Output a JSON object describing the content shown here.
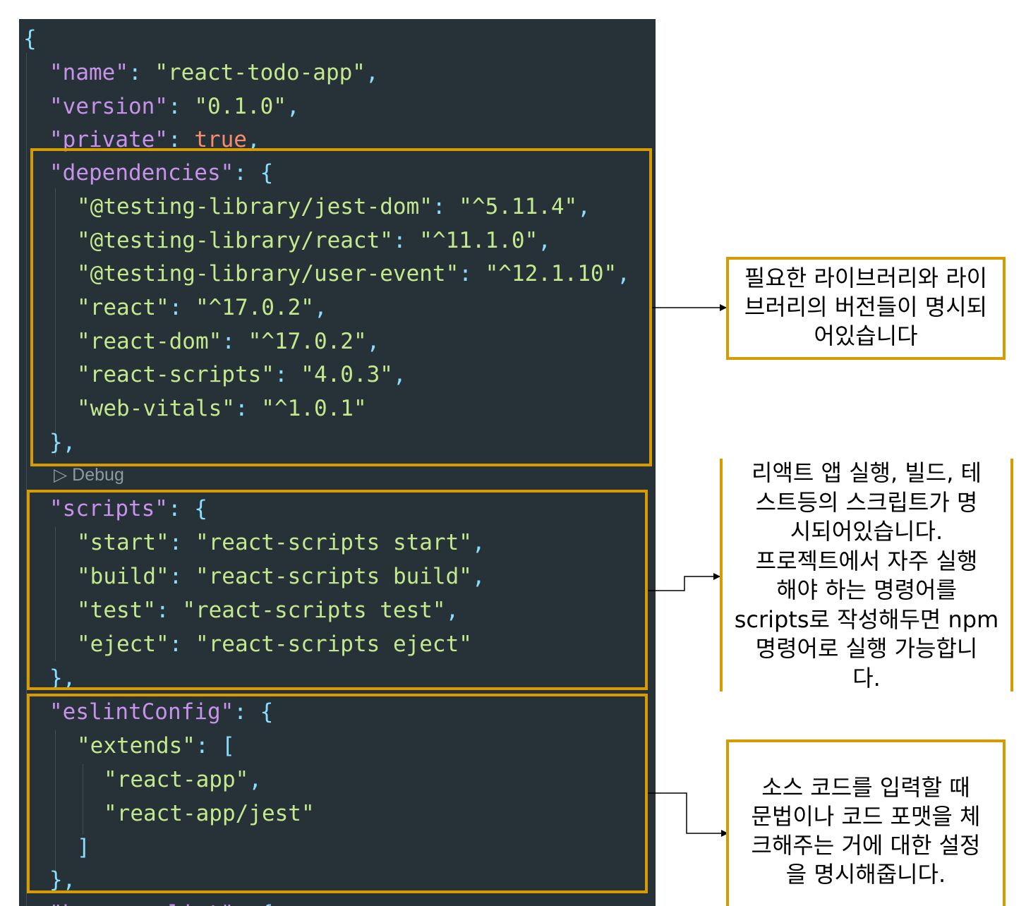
{
  "code_lines": [
    {
      "t": [
        {
          "c": "p",
          "v": "{"
        }
      ]
    },
    {
      "t": [
        {
          "c": "k",
          "v": "\"name\""
        },
        {
          "c": "p",
          "v": ": "
        },
        {
          "c": "s",
          "v": "\"react-todo-app\""
        },
        {
          "c": "p",
          "v": ","
        }
      ]
    },
    {
      "t": [
        {
          "c": "k",
          "v": "\"version\""
        },
        {
          "c": "p",
          "v": ": "
        },
        {
          "c": "s",
          "v": "\"0.1.0\""
        },
        {
          "c": "p",
          "v": ","
        }
      ]
    },
    {
      "t": [
        {
          "c": "k",
          "v": "\"private\""
        },
        {
          "c": "p",
          "v": ": "
        },
        {
          "c": "b",
          "v": "true"
        },
        {
          "c": "p",
          "v": ","
        }
      ]
    },
    {
      "t": [
        {
          "c": "k",
          "v": "\"dependencies\""
        },
        {
          "c": "p",
          "v": ": {"
        }
      ]
    },
    {
      "t": [
        {
          "c": "s",
          "v": "\"@testing-library/jest-dom\""
        },
        {
          "c": "p",
          "v": ": "
        },
        {
          "c": "s",
          "v": "\"^5.11.4\""
        },
        {
          "c": "p",
          "v": ","
        }
      ]
    },
    {
      "t": [
        {
          "c": "s",
          "v": "\"@testing-library/react\""
        },
        {
          "c": "p",
          "v": ": "
        },
        {
          "c": "s",
          "v": "\"^11.1.0\""
        },
        {
          "c": "p",
          "v": ","
        }
      ]
    },
    {
      "t": [
        {
          "c": "s",
          "v": "\"@testing-library/user-event\""
        },
        {
          "c": "p",
          "v": ": "
        },
        {
          "c": "s",
          "v": "\"^12.1.10\""
        },
        {
          "c": "p",
          "v": ","
        }
      ]
    },
    {
      "t": [
        {
          "c": "s",
          "v": "\"react\""
        },
        {
          "c": "p",
          "v": ": "
        },
        {
          "c": "s",
          "v": "\"^17.0.2\""
        },
        {
          "c": "p",
          "v": ","
        }
      ]
    },
    {
      "t": [
        {
          "c": "s",
          "v": "\"react-dom\""
        },
        {
          "c": "p",
          "v": ": "
        },
        {
          "c": "s",
          "v": "\"^17.0.2\""
        },
        {
          "c": "p",
          "v": ","
        }
      ]
    },
    {
      "t": [
        {
          "c": "s",
          "v": "\"react-scripts\""
        },
        {
          "c": "p",
          "v": ": "
        },
        {
          "c": "s",
          "v": "\"4.0.3\""
        },
        {
          "c": "p",
          "v": ","
        }
      ]
    },
    {
      "t": [
        {
          "c": "s",
          "v": "\"web-vitals\""
        },
        {
          "c": "p",
          "v": ": "
        },
        {
          "c": "s",
          "v": "\"^1.0.1\""
        }
      ]
    },
    {
      "t": [
        {
          "c": "p",
          "v": "},"
        }
      ]
    },
    {
      "t": [
        {
          "c": "k",
          "v": "\"scripts\""
        },
        {
          "c": "p",
          "v": ": {"
        }
      ]
    },
    {
      "t": [
        {
          "c": "s",
          "v": "\"start\""
        },
        {
          "c": "p",
          "v": ": "
        },
        {
          "c": "s",
          "v": "\"react-scripts start\""
        },
        {
          "c": "p",
          "v": ","
        }
      ]
    },
    {
      "t": [
        {
          "c": "s",
          "v": "\"build\""
        },
        {
          "c": "p",
          "v": ": "
        },
        {
          "c": "s",
          "v": "\"react-scripts build\""
        },
        {
          "c": "p",
          "v": ","
        }
      ]
    },
    {
      "t": [
        {
          "c": "s",
          "v": "\"test\""
        },
        {
          "c": "p",
          "v": ": "
        },
        {
          "c": "s",
          "v": "\"react-scripts test\""
        },
        {
          "c": "p",
          "v": ","
        }
      ]
    },
    {
      "t": [
        {
          "c": "s",
          "v": "\"eject\""
        },
        {
          "c": "p",
          "v": ": "
        },
        {
          "c": "s",
          "v": "\"react-scripts eject\""
        }
      ]
    },
    {
      "t": [
        {
          "c": "p",
          "v": "},"
        }
      ]
    },
    {
      "t": [
        {
          "c": "k",
          "v": "\"eslintConfig\""
        },
        {
          "c": "p",
          "v": ": {"
        }
      ]
    },
    {
      "t": [
        {
          "c": "s",
          "v": "\"extends\""
        },
        {
          "c": "p",
          "v": ": ["
        }
      ]
    },
    {
      "t": [
        {
          "c": "s",
          "v": "\"react-app\""
        },
        {
          "c": "p",
          "v": ","
        }
      ]
    },
    {
      "t": [
        {
          "c": "s",
          "v": "\"react-app/jest\""
        }
      ]
    },
    {
      "t": [
        {
          "c": "p",
          "v": "]"
        }
      ]
    },
    {
      "t": [
        {
          "c": "p",
          "v": "},"
        }
      ]
    },
    {
      "t": [
        {
          "c": "k",
          "v": "\"browserslist\""
        },
        {
          "c": "p",
          "v": ": {"
        }
      ]
    }
  ],
  "codelens": "▷ Debug",
  "notes": {
    "dependencies": "필요한 라이브러리와 라이\n브러리의 버전들이 명시되\n어있습니다",
    "scripts": "리액트 앱 실행, 빌드, 테\n스트등의 스크립트가 명\n시되어있습니다.\n프로젝트에서 자주 실행\n해야 하는 명령어를\nscripts로 작성해두면 npm\n명령어로 실행 가능합니\n다.",
    "eslint": "소스 코드를 입력할 때\n문법이나 코드 포맷을 체\n크해주는 거에 대한 설정\n을 명시해줍니다."
  },
  "colors": {
    "editor_bg": "#263238",
    "highlight": "#d79b00",
    "key": "#c792ea",
    "string": "#c3e88d",
    "punct": "#89ddff",
    "boolean": "#f78c6c"
  }
}
